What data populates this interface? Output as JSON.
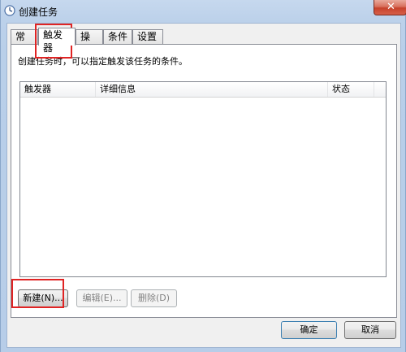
{
  "window": {
    "title": "创建任务",
    "close_label": "✕"
  },
  "tabs": [
    {
      "label": "常规",
      "active": false
    },
    {
      "label": "触发器",
      "active": true
    },
    {
      "label": "操作",
      "active": false
    },
    {
      "label": "条件",
      "active": false
    },
    {
      "label": "设置",
      "active": false
    }
  ],
  "triggers": {
    "description": "创建任务时，可以指定触发该任务的条件。",
    "columns": [
      "触发器",
      "详细信息",
      "状态"
    ],
    "rows": [],
    "buttons": {
      "new": "新建(N)...",
      "edit": "编辑(E)...",
      "delete": "删除(D)"
    }
  },
  "footer": {
    "ok": "确定",
    "cancel": "取消"
  },
  "colors": {
    "highlight": "#e02424",
    "title_bar": "#c6d8ee",
    "close_button": "#c7422b"
  }
}
